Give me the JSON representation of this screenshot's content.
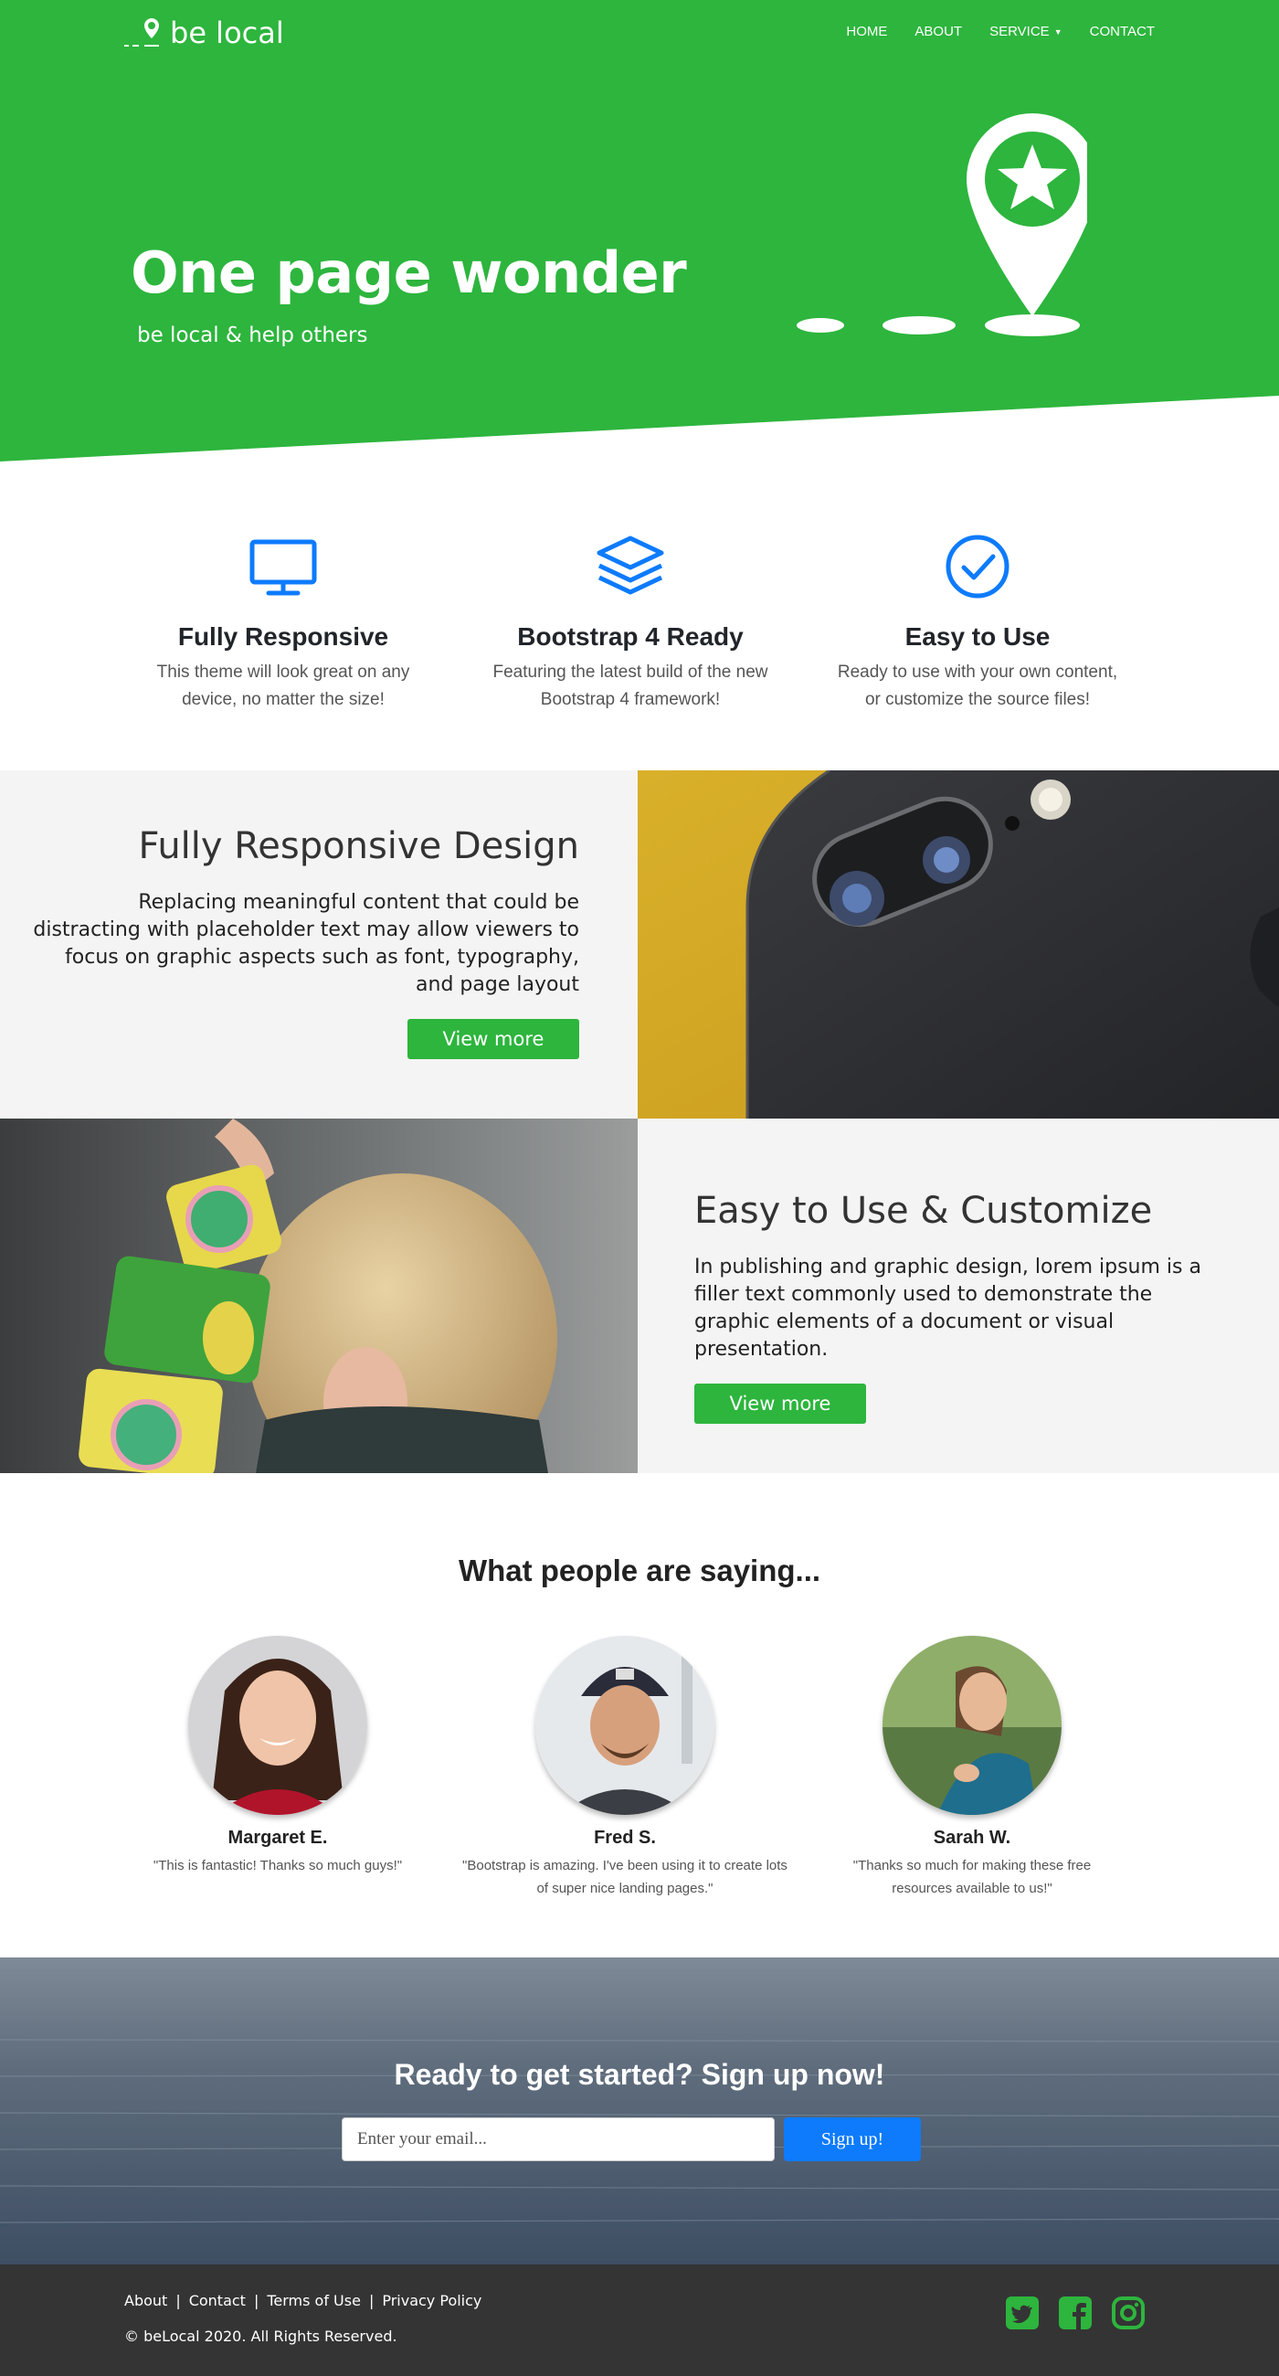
{
  "brand": {
    "name": "be local",
    "color_primary": "#2db53d",
    "color_secondary": "#0d7bfc"
  },
  "nav": {
    "items": [
      {
        "label": "HOME"
      },
      {
        "label": "ABOUT"
      },
      {
        "label": "SERVICE"
      },
      {
        "label": "CONTACT"
      }
    ]
  },
  "hero": {
    "title": "One page wonder",
    "subtitle": "be local & help others",
    "icon": "map-pin-star-icon"
  },
  "features": [
    {
      "icon": "monitor-icon",
      "title": "Fully Responsive",
      "text": "This theme will look great on any device, no matter the size!"
    },
    {
      "icon": "layers-icon",
      "title": "Bootstrap 4 Ready",
      "text": "Featuring the latest build of the new Bootstrap 4 framework!"
    },
    {
      "icon": "check-circle-icon",
      "title": "Easy to Use",
      "text": "Ready to use with your own content, or customize the source files!"
    }
  ],
  "showcase": [
    {
      "title": "Fully Responsive Design",
      "text": "Replacing meaningful content that could be distracting with placeholder text may allow viewers to focus on graphic aspects such as font, typography, and page layout",
      "button": "View more"
    },
    {
      "title": "Easy to Use & Customize",
      "text": "In publishing and graphic design, lorem ipsum is a filler text commonly used to demonstrate the graphic elements of a document or visual presentation.",
      "button": "View more"
    }
  ],
  "testimonials": {
    "title": "What people are saying...",
    "items": [
      {
        "name": "Margaret E.",
        "quote": "\"This is fantastic! Thanks so much guys!\""
      },
      {
        "name": "Fred S.",
        "quote": "\"Bootstrap is amazing. I've been using it to create lots of super nice landing pages.\""
      },
      {
        "name": "Sarah W.",
        "quote": "\"Thanks so much for making these free resources available to us!\""
      }
    ]
  },
  "cta": {
    "title": "Ready to get started? Sign up now!",
    "placeholder": "Enter your email...",
    "button": "Sign up!"
  },
  "footer": {
    "links": [
      {
        "label": "About"
      },
      {
        "label": "Contact"
      },
      {
        "label": "Terms of Use"
      },
      {
        "label": "Privacy Policy"
      }
    ],
    "copyright": "© beLocal 2020. All Rights Reserved.",
    "social": [
      "twitter-icon",
      "facebook-icon",
      "instagram-icon"
    ]
  }
}
